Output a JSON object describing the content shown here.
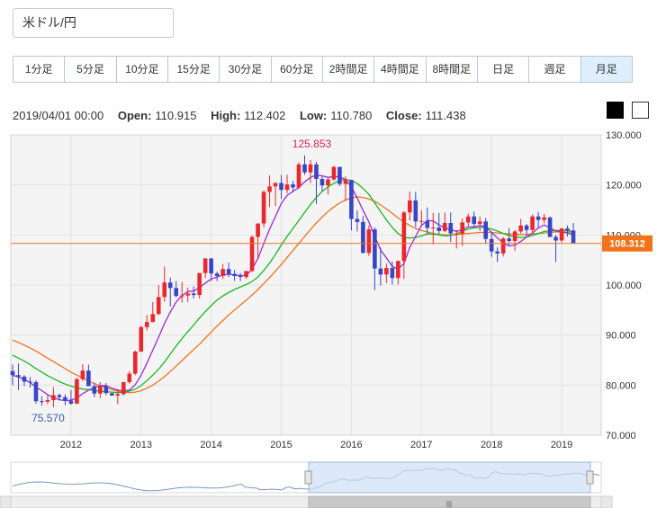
{
  "pair": "米ドル/円",
  "timeframes": [
    "1分足",
    "5分足",
    "10分足",
    "15分足",
    "30分足",
    "60分足",
    "2時間足",
    "4時間足",
    "8時間足",
    "日足",
    "週足",
    "月足"
  ],
  "active_timeframe": "月足",
  "ohlc": {
    "datetime": "2019/04/01 00:00",
    "open_label": "Open:",
    "open": "110.915",
    "high_label": "High:",
    "high": "112.402",
    "low_label": "Low:",
    "low": "110.780",
    "close_label": "Close:",
    "close": "111.438"
  },
  "colors": {
    "up": "#e8282d",
    "down": "#3845c6",
    "ma_fast": "#9b2be0",
    "ma_mid": "#19b81e",
    "ma_slow": "#f2731a",
    "price_line": "#f2731a",
    "plot_bg": "#f4f4f4"
  },
  "chart_data": {
    "type": "candlestick",
    "ylim": [
      70,
      130
    ],
    "yticks": [
      "130.000",
      "120.000",
      "110.000",
      "100.000",
      "90.000",
      "80.000",
      "70.000"
    ],
    "xticks": [
      "2012",
      "2013",
      "2014",
      "2015",
      "2016",
      "2017",
      "2018",
      "2019"
    ],
    "current_price": "108.312",
    "annotations": {
      "high": "125.853",
      "low": "75.570"
    },
    "start": "2011-03",
    "candles": [
      [
        82.8,
        84.1,
        80.0,
        82.0
      ],
      [
        82.0,
        84.3,
        79.0,
        81.7
      ],
      [
        81.7,
        82.0,
        79.8,
        80.7
      ],
      [
        80.7,
        81.6,
        79.5,
        80.6
      ],
      [
        80.6,
        81.0,
        76.3,
        76.8
      ],
      [
        76.8,
        77.8,
        75.9,
        76.7
      ],
      [
        76.7,
        78.0,
        76.2,
        77.0
      ],
      [
        77.0,
        79.6,
        75.6,
        78.0
      ],
      [
        78.0,
        78.3,
        76.9,
        77.6
      ],
      [
        77.6,
        78.2,
        76.0,
        76.9
      ],
      [
        76.9,
        79.0,
        76.1,
        76.3
      ],
      [
        76.3,
        81.5,
        76.2,
        81.2
      ],
      [
        81.2,
        84.2,
        80.8,
        82.9
      ],
      [
        82.9,
        84.1,
        79.8,
        79.8
      ],
      [
        79.8,
        80.5,
        77.6,
        78.3
      ],
      [
        78.3,
        80.6,
        77.4,
        79.8
      ],
      [
        79.8,
        80.4,
        78.0,
        78.4
      ],
      [
        78.4,
        78.3,
        77.9,
        77.9
      ],
      [
        77.9,
        79.2,
        76.2,
        78.2
      ],
      [
        78.2,
        80.7,
        77.9,
        80.6
      ],
      [
        80.6,
        82.8,
        80.3,
        82.3
      ],
      [
        82.3,
        86.9,
        82.0,
        86.7
      ],
      [
        86.7,
        91.8,
        86.6,
        91.6
      ],
      [
        91.6,
        94.0,
        90.9,
        92.6
      ],
      [
        92.6,
        96.6,
        92.6,
        94.2
      ],
      [
        94.2,
        100.0,
        94.0,
        97.6
      ],
      [
        97.6,
        103.7,
        96.7,
        100.5
      ],
      [
        100.5,
        101.5,
        95.7,
        99.4
      ],
      [
        99.4,
        100.8,
        97.6,
        97.8
      ],
      [
        97.8,
        100.6,
        96.5,
        97.9
      ],
      [
        97.9,
        99.5,
        96.6,
        98.3
      ],
      [
        98.3,
        99.7,
        97.3,
        98.0
      ],
      [
        98.0,
        102.2,
        97.3,
        102.4
      ],
      [
        102.4,
        105.4,
        101.4,
        105.3
      ],
      [
        105.3,
        105.4,
        100.8,
        102.3
      ],
      [
        102.3,
        102.7,
        100.8,
        101.8
      ],
      [
        101.8,
        104.2,
        101.2,
        103.2
      ],
      [
        103.2,
        104.5,
        101.6,
        102.2
      ],
      [
        102.2,
        103.0,
        100.8,
        101.8
      ],
      [
        101.8,
        102.4,
        100.8,
        101.6
      ],
      [
        101.6,
        102.6,
        101.2,
        102.8
      ],
      [
        102.8,
        109.9,
        102.6,
        109.6
      ],
      [
        109.6,
        110.1,
        105.2,
        112.3
      ],
      [
        112.3,
        118.9,
        111.5,
        118.6
      ],
      [
        118.6,
        121.9,
        115.6,
        119.7
      ],
      [
        119.7,
        120.3,
        115.8,
        120.4
      ],
      [
        120.4,
        122.0,
        117.2,
        119.0
      ],
      [
        119.0,
        122.0,
        118.3,
        120.1
      ],
      [
        120.1,
        120.8,
        118.5,
        119.5
      ],
      [
        119.5,
        124.5,
        119.1,
        124.1
      ],
      [
        124.1,
        125.9,
        122.0,
        122.5
      ],
      [
        122.5,
        125.0,
        120.4,
        124.1
      ],
      [
        124.1,
        124.6,
        116.2,
        121.2
      ],
      [
        121.2,
        121.7,
        118.6,
        119.9
      ],
      [
        119.9,
        121.5,
        118.1,
        121.1
      ],
      [
        121.1,
        123.8,
        120.8,
        123.6
      ],
      [
        123.6,
        123.6,
        119.8,
        120.2
      ],
      [
        120.2,
        121.7,
        116.8,
        121.0
      ],
      [
        121.0,
        118.9,
        110.9,
        113.2
      ],
      [
        113.2,
        114.9,
        110.7,
        112.6
      ],
      [
        112.6,
        113.8,
        107.6,
        106.4
      ],
      [
        106.4,
        111.9,
        105.8,
        111.1
      ],
      [
        111.1,
        111.5,
        99.0,
        103.3
      ],
      [
        103.3,
        107.5,
        99.9,
        102.1
      ],
      [
        102.1,
        104.3,
        100.4,
        103.4
      ],
      [
        103.4,
        104.7,
        100.1,
        101.4
      ],
      [
        101.4,
        104.9,
        100.1,
        104.8
      ],
      [
        104.8,
        114.8,
        101.2,
        114.5
      ],
      [
        114.5,
        118.7,
        112.9,
        116.9
      ],
      [
        116.9,
        118.6,
        111.6,
        112.7
      ],
      [
        112.7,
        114.9,
        111.7,
        112.8
      ],
      [
        112.8,
        115.5,
        110.1,
        111.4
      ],
      [
        111.4,
        114.4,
        108.1,
        111.5
      ],
      [
        111.5,
        114.4,
        110.2,
        110.8
      ],
      [
        110.8,
        114.5,
        110.6,
        112.4
      ],
      [
        112.4,
        114.5,
        108.6,
        110.3
      ],
      [
        110.3,
        111.0,
        107.3,
        110.3
      ],
      [
        110.3,
        113.3,
        107.8,
        112.5
      ],
      [
        112.5,
        114.3,
        111.7,
        113.7
      ],
      [
        113.7,
        114.7,
        111.7,
        112.2
      ],
      [
        112.2,
        113.7,
        110.8,
        112.7
      ],
      [
        112.7,
        113.4,
        108.3,
        109.2
      ],
      [
        109.2,
        110.5,
        105.6,
        106.7
      ],
      [
        106.7,
        107.5,
        104.6,
        106.3
      ],
      [
        106.3,
        109.6,
        105.7,
        109.3
      ],
      [
        109.3,
        111.4,
        108.0,
        108.8
      ],
      [
        108.8,
        111.0,
        106.8,
        110.7
      ],
      [
        110.7,
        113.2,
        110.3,
        111.9
      ],
      [
        111.9,
        112.2,
        109.8,
        111.0
      ],
      [
        111.0,
        114.1,
        110.4,
        113.7
      ],
      [
        113.7,
        114.6,
        111.4,
        113.0
      ],
      [
        113.0,
        114.2,
        112.3,
        113.5
      ],
      [
        113.5,
        113.7,
        109.6,
        109.6
      ],
      [
        109.6,
        110.0,
        104.6,
        108.9
      ],
      [
        108.9,
        111.4,
        108.5,
        111.3
      ],
      [
        111.3,
        111.9,
        109.7,
        110.9
      ],
      [
        110.9,
        112.4,
        110.8,
        108.3
      ]
    ],
    "ma_fast": [
      82.0,
      81.6,
      81.2,
      80.5,
      79.6,
      78.9,
      78.1,
      77.5,
      77.1,
      76.9,
      77.0,
      77.4,
      78.3,
      79.0,
      79.6,
      79.9,
      79.9,
      79.4,
      79.0,
      78.9,
      79.0,
      80.1,
      82.0,
      84.4,
      87.0,
      89.6,
      92.3,
      94.6,
      96.6,
      97.9,
      98.7,
      98.8,
      99.5,
      100.4,
      101.2,
      101.6,
      102.0,
      102.2,
      102.0,
      101.9,
      101.9,
      103.2,
      105.3,
      108.3,
      111.2,
      113.7,
      116.3,
      117.9,
      118.7,
      119.5,
      120.6,
      121.5,
      122.0,
      121.8,
      121.5,
      121.7,
      121.6,
      121.1,
      119.6,
      117.4,
      114.9,
      112.6,
      109.7,
      107.0,
      105.4,
      103.7,
      103.2,
      104.3,
      107.5,
      109.7,
      111.9,
      112.9,
      112.8,
      112.0,
      111.4,
      111.1,
      110.7,
      111.1,
      111.6,
      111.6,
      111.9,
      111.6,
      110.5,
      109.4,
      108.4,
      107.8,
      108.0,
      108.7,
      109.6,
      110.4,
      111.4,
      112.0,
      111.4,
      110.8,
      110.6,
      110.4,
      110.0
    ],
    "ma_mid": [
      86.0,
      85.4,
      84.8,
      84.1,
      83.3,
      82.6,
      81.9,
      81.3,
      80.7,
      80.2,
      79.8,
      79.5,
      79.2,
      79.1,
      78.9,
      78.8,
      78.7,
      78.6,
      78.5,
      78.6,
      78.8,
      79.2,
      79.9,
      80.9,
      82.0,
      83.2,
      84.6,
      86.2,
      87.8,
      89.3,
      90.7,
      92.0,
      93.4,
      94.7,
      95.9,
      97.0,
      97.8,
      98.5,
      99.1,
      99.6,
      100.1,
      100.7,
      101.6,
      102.9,
      104.4,
      106.1,
      108.0,
      109.7,
      111.3,
      112.9,
      114.5,
      116.1,
      117.5,
      118.7,
      119.6,
      120.3,
      120.9,
      121.1,
      120.9,
      120.3,
      119.3,
      118.1,
      116.4,
      114.7,
      113.0,
      111.5,
      110.3,
      109.5,
      109.4,
      109.5,
      109.8,
      110.2,
      110.2,
      110.0,
      109.8,
      109.9,
      110.2,
      110.8,
      111.2,
      111.4,
      111.5,
      111.5,
      111.2,
      110.8,
      110.3,
      109.9,
      109.6,
      109.5,
      109.6,
      109.9,
      110.3,
      110.7,
      110.8,
      110.9,
      110.9,
      110.9,
      110.6
    ],
    "ma_slow": [
      89.0,
      88.5,
      88.0,
      87.4,
      86.8,
      86.1,
      85.4,
      84.7,
      84.0,
      83.3,
      82.6,
      82.0,
      81.4,
      80.8,
      80.3,
      79.9,
      79.5,
      79.1,
      78.8,
      78.6,
      78.5,
      78.6,
      78.9,
      79.4,
      80.0,
      80.8,
      81.7,
      82.7,
      83.8,
      84.9,
      86.0,
      87.1,
      88.2,
      89.4,
      90.6,
      91.8,
      92.9,
      94.0,
      95.0,
      96.0,
      97.0,
      98.0,
      99.1,
      100.3,
      101.5,
      102.8,
      104.1,
      105.5,
      106.9,
      108.3,
      109.7,
      111.1,
      112.4,
      113.6,
      114.7,
      115.6,
      116.4,
      117.0,
      117.4,
      117.6,
      117.5,
      117.2,
      116.7,
      116.0,
      115.2,
      114.3,
      113.4,
      112.6,
      111.9,
      111.3,
      110.9,
      110.6,
      110.3,
      110.1,
      110.0,
      110.0,
      110.1,
      110.2,
      110.3,
      110.4,
      110.5,
      110.5,
      110.5,
      110.4,
      110.3,
      110.2,
      110.1,
      110.1,
      110.1,
      110.2,
      110.3,
      110.4,
      110.5,
      110.6,
      110.6,
      110.6,
      110.5
    ]
  },
  "navigator": {
    "scroll_label": "|||"
  }
}
